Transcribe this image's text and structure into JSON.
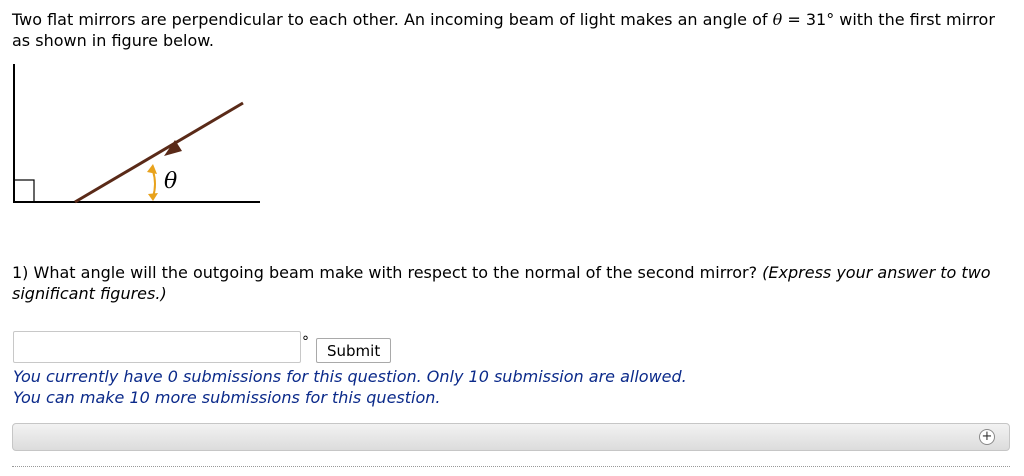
{
  "problem": {
    "text_before": "Two flat mirrors are perpendicular to each other. An incoming beam of light makes an angle of ",
    "symbol": "θ",
    "text_after": " = 31° with the first mirror as shown in figure below."
  },
  "figure": {
    "angle_label": "θ"
  },
  "question": {
    "text": "1) What angle will the outgoing beam make with respect to the normal of the second mirror? ",
    "hint": "(Express your answer to two significant figures.)"
  },
  "answer": {
    "value": "",
    "unit": "°",
    "submit_label": "Submit"
  },
  "status": {
    "line1": "You currently have 0 submissions for this question. Only 10 submission are allowed.",
    "line2": "You can make 10 more submissions for this question."
  },
  "colors": {
    "beam": "#5a2a18",
    "angle_arrow": "#e8a21c",
    "status_text": "#0b2a8a"
  },
  "icons": {
    "expand": "plus-icon"
  }
}
